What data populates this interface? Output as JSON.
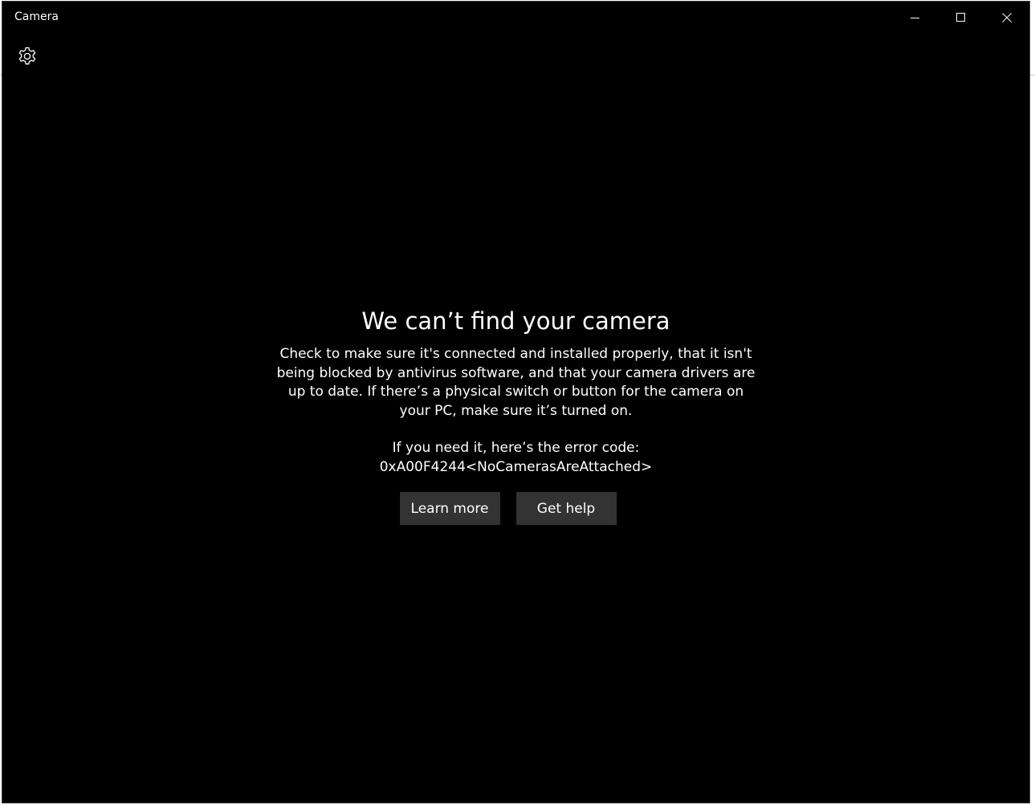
{
  "window": {
    "title": "Camera",
    "controls": [
      "minimize-icon",
      "maximize-icon",
      "close-icon"
    ]
  },
  "toolbar": {
    "settings_icon": "gear-icon"
  },
  "message": {
    "heading": "We can’t find your camera",
    "description": "Check to make sure it's connected and installed properly, that it isn't being blocked by antivirus software, and that your camera drivers are up to date. If there’s a physical switch or button for the camera on your PC, make sure it’s turned on.",
    "error_intro": "If you need it, here’s the error code:",
    "error_code": "0xA00F4244<NoCamerasAreAttached>"
  },
  "buttons": {
    "learn_more": "Learn more",
    "get_help": "Get help"
  },
  "colors": {
    "background": "#000000",
    "text": "#ffffff",
    "button": "#333333"
  }
}
